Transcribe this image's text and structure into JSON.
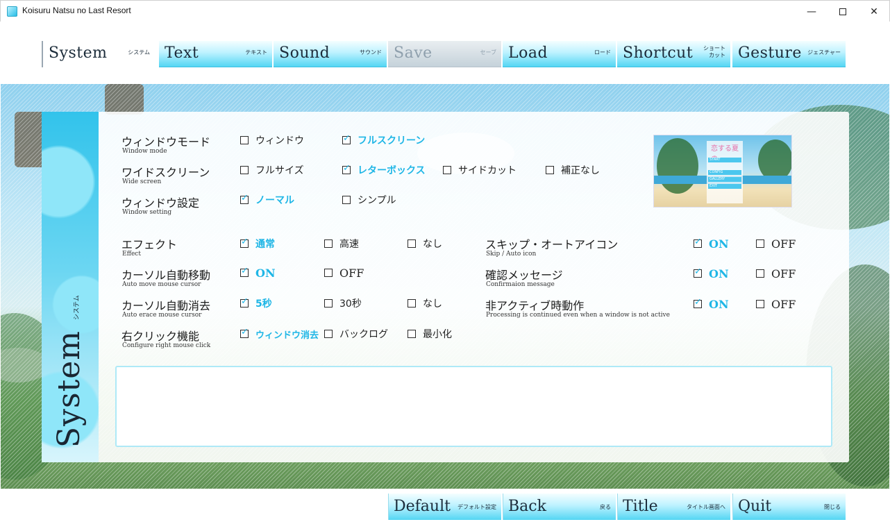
{
  "window": {
    "title": "Koisuru Natsu no Last Resort",
    "minimize": "—",
    "close": "✕"
  },
  "tabs": [
    {
      "en": "System",
      "jp": "システム"
    },
    {
      "en": "Text",
      "jp": "テキスト"
    },
    {
      "en": "Sound",
      "jp": "サウンド"
    },
    {
      "en": "Save",
      "jp": "セーブ"
    },
    {
      "en": "Load",
      "jp": "ロード"
    },
    {
      "en": "Shortcut",
      "jp": "ショート\nカット"
    },
    {
      "en": "Gesture",
      "jp": "ジェスチャー"
    }
  ],
  "panel": {
    "side_en": "System",
    "side_jp": "システム"
  },
  "options": [
    {
      "label": "ウィンドウモード",
      "sub": "Window mode",
      "choices": [
        {
          "text": "ウィンドウ",
          "checked": false
        },
        {
          "text": "フルスクリーン",
          "checked": true
        }
      ]
    },
    {
      "label": "ワイドスクリーン",
      "sub": "Wide screen",
      "choices": [
        {
          "text": "フルサイズ",
          "checked": false
        },
        {
          "text": "レターボックス",
          "checked": true
        },
        {
          "text": "サイドカット",
          "checked": false
        },
        {
          "text": "補正なし",
          "checked": false
        }
      ]
    },
    {
      "label": "ウィンドウ設定",
      "sub": "Window setting",
      "choices": [
        {
          "text": "ノーマル",
          "checked": true
        },
        {
          "text": "シンプル",
          "checked": false
        }
      ]
    },
    {
      "label": "エフェクト",
      "sub": "Effect",
      "choices": [
        {
          "text": "通常",
          "checked": true
        },
        {
          "text": "高速",
          "checked": false
        },
        {
          "text": "なし",
          "checked": false
        }
      ]
    },
    {
      "label": "カーソル自動移動",
      "sub": "Auto move mouse cursor",
      "choices": [
        {
          "text": "ON",
          "checked": true
        },
        {
          "text": "OFF",
          "checked": false
        }
      ]
    },
    {
      "label": "カーソル自動消去",
      "sub": "Auto erace mouse cursor",
      "choices": [
        {
          "text": "5秒",
          "checked": true
        },
        {
          "text": "30秒",
          "checked": false
        },
        {
          "text": "なし",
          "checked": false
        }
      ]
    },
    {
      "label": "右クリック機能",
      "sub": "Configure right mouse click",
      "choices": [
        {
          "text": "ウィンドウ消去",
          "checked": true
        },
        {
          "text": "バックログ",
          "checked": false
        },
        {
          "text": "最小化",
          "checked": false
        }
      ]
    },
    {
      "label": "スキップ・オートアイコン",
      "sub": "Skip / Auto icon",
      "choices": [
        {
          "text": "ON",
          "checked": true
        },
        {
          "text": "OFF",
          "checked": false
        }
      ]
    },
    {
      "label": "確認メッセージ",
      "sub": "Confirmaion message",
      "choices": [
        {
          "text": "ON",
          "checked": true
        },
        {
          "text": "OFF",
          "checked": false
        }
      ]
    },
    {
      "label": "非アクティブ時動作",
      "sub": "Processing is continued even when a window is not active",
      "choices": [
        {
          "text": "ON",
          "checked": true
        },
        {
          "text": "OFF",
          "checked": false
        }
      ]
    }
  ],
  "preview": {
    "logo": "恋する夏の",
    "buttons": [
      "START",
      "CONFIG",
      "GALLERY",
      "EXIT"
    ]
  },
  "bottom": [
    {
      "en": "Default",
      "jp": "デフォルト設定"
    },
    {
      "en": "Back",
      "jp": "戻る"
    },
    {
      "en": "Title",
      "jp": "タイトル画面へ"
    },
    {
      "en": "Quit",
      "jp": "閉じる"
    }
  ]
}
